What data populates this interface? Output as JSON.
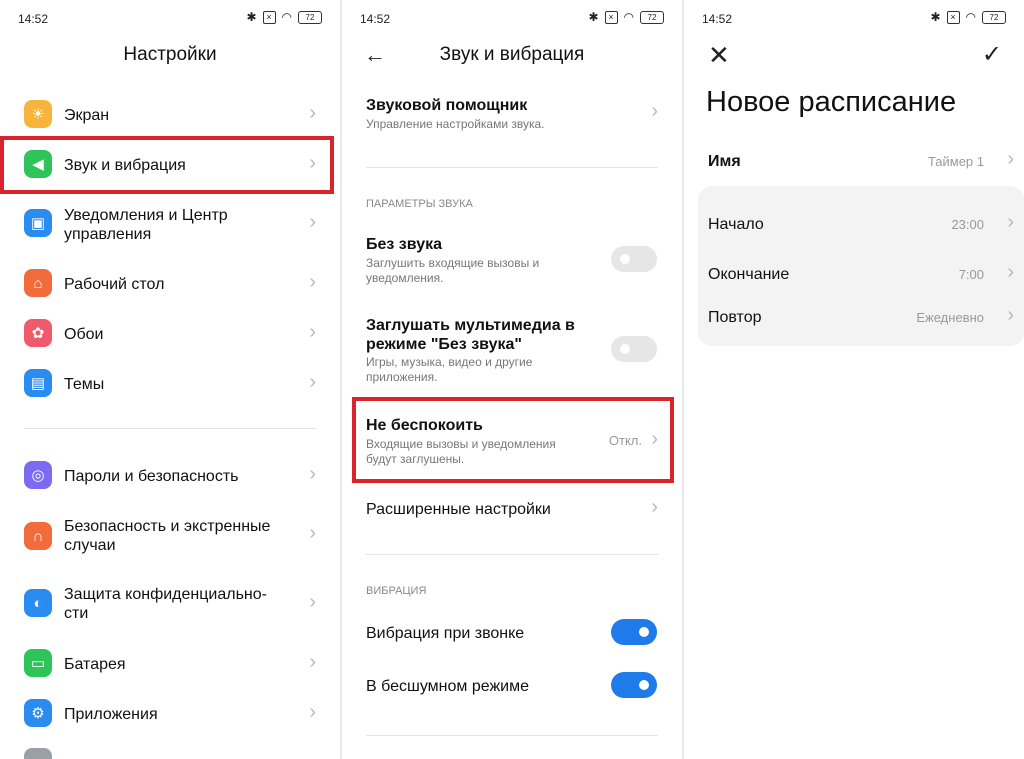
{
  "status": {
    "time": "14:52",
    "battery": "72"
  },
  "panel1": {
    "title": "Настройки",
    "items": [
      {
        "label": "Экран",
        "icon": "sun-icon",
        "color": "#f6b43c"
      },
      {
        "label": "Звук и вибрация",
        "icon": "speaker-icon",
        "color": "#2fc45a"
      },
      {
        "label": "Уведомления и Центр управления",
        "icon": "notification-icon",
        "color": "#2a8cf0"
      },
      {
        "label": "Рабочий стол",
        "icon": "home-icon",
        "color": "#f16b3b"
      },
      {
        "label": "Обои",
        "icon": "flower-icon",
        "color": "#f05a6b"
      },
      {
        "label": "Темы",
        "icon": "brush-icon",
        "color": "#2a8cf0"
      },
      {
        "label": "Пароли и безопасность",
        "icon": "fingerprint-icon",
        "color": "#7c6bf0"
      },
      {
        "label": "Безопасность и экстренные случаи",
        "icon": "emergency-icon",
        "color": "#f16b3b"
      },
      {
        "label": "Защита конфиденциально-сти",
        "icon": "privacy-icon",
        "color": "#2a8cf0"
      },
      {
        "label": "Батарея",
        "icon": "battery-icon",
        "color": "#2fc45a"
      },
      {
        "label": "Приложения",
        "icon": "gear-icon",
        "color": "#2a8cf0"
      }
    ]
  },
  "panel2": {
    "title": "Звук и вибрация",
    "assistant": {
      "title": "Звуковой помощник",
      "sub": "Управление настройками звука."
    },
    "sound_section": "ПАРАМЕТРЫ ЗВУКА",
    "silent": {
      "title": "Без звука",
      "sub": "Заглушить входящие вызовы и уведомления.",
      "on": false
    },
    "mute_media": {
      "title": "Заглушать мультимедиа в режиме \"Без звука\"",
      "sub": "Игры, музыка, видео и другие приложения.",
      "on": false
    },
    "dnd": {
      "title": "Не беспокоить",
      "sub": "Входящие вызовы и уведомления будут заглушены.",
      "value": "Откл."
    },
    "advanced": {
      "title": "Расширенные настройки"
    },
    "vibration_section": "ВИБРАЦИЯ",
    "vib_ring": {
      "title": "Вибрация при звонке",
      "on": true
    },
    "vib_silent": {
      "title": "В бесшумном режиме",
      "on": true
    }
  },
  "panel3": {
    "title": "Новое расписание",
    "name": {
      "label": "Имя",
      "value": "Таймер 1"
    },
    "start": {
      "label": "Начало",
      "value": "23:00"
    },
    "end": {
      "label": "Окончание",
      "value": "7:00"
    },
    "repeat": {
      "label": "Повтор",
      "value": "Ежедневно"
    }
  },
  "colors": {
    "highlight": "#d8252c",
    "accent": "#1f7bea"
  }
}
